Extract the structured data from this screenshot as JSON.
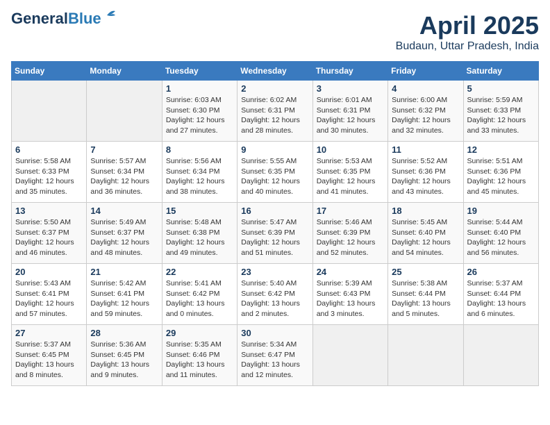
{
  "header": {
    "logo_line1": "General",
    "logo_line2": "Blue",
    "month_year": "April 2025",
    "location": "Budaun, Uttar Pradesh, India"
  },
  "days_of_week": [
    "Sunday",
    "Monday",
    "Tuesday",
    "Wednesday",
    "Thursday",
    "Friday",
    "Saturday"
  ],
  "weeks": [
    [
      {
        "day": "",
        "info": ""
      },
      {
        "day": "",
        "info": ""
      },
      {
        "day": "1",
        "info": "Sunrise: 6:03 AM\nSunset: 6:30 PM\nDaylight: 12 hours and 27 minutes."
      },
      {
        "day": "2",
        "info": "Sunrise: 6:02 AM\nSunset: 6:31 PM\nDaylight: 12 hours and 28 minutes."
      },
      {
        "day": "3",
        "info": "Sunrise: 6:01 AM\nSunset: 6:31 PM\nDaylight: 12 hours and 30 minutes."
      },
      {
        "day": "4",
        "info": "Sunrise: 6:00 AM\nSunset: 6:32 PM\nDaylight: 12 hours and 32 minutes."
      },
      {
        "day": "5",
        "info": "Sunrise: 5:59 AM\nSunset: 6:33 PM\nDaylight: 12 hours and 33 minutes."
      }
    ],
    [
      {
        "day": "6",
        "info": "Sunrise: 5:58 AM\nSunset: 6:33 PM\nDaylight: 12 hours and 35 minutes."
      },
      {
        "day": "7",
        "info": "Sunrise: 5:57 AM\nSunset: 6:34 PM\nDaylight: 12 hours and 36 minutes."
      },
      {
        "day": "8",
        "info": "Sunrise: 5:56 AM\nSunset: 6:34 PM\nDaylight: 12 hours and 38 minutes."
      },
      {
        "day": "9",
        "info": "Sunrise: 5:55 AM\nSunset: 6:35 PM\nDaylight: 12 hours and 40 minutes."
      },
      {
        "day": "10",
        "info": "Sunrise: 5:53 AM\nSunset: 6:35 PM\nDaylight: 12 hours and 41 minutes."
      },
      {
        "day": "11",
        "info": "Sunrise: 5:52 AM\nSunset: 6:36 PM\nDaylight: 12 hours and 43 minutes."
      },
      {
        "day": "12",
        "info": "Sunrise: 5:51 AM\nSunset: 6:36 PM\nDaylight: 12 hours and 45 minutes."
      }
    ],
    [
      {
        "day": "13",
        "info": "Sunrise: 5:50 AM\nSunset: 6:37 PM\nDaylight: 12 hours and 46 minutes."
      },
      {
        "day": "14",
        "info": "Sunrise: 5:49 AM\nSunset: 6:37 PM\nDaylight: 12 hours and 48 minutes."
      },
      {
        "day": "15",
        "info": "Sunrise: 5:48 AM\nSunset: 6:38 PM\nDaylight: 12 hours and 49 minutes."
      },
      {
        "day": "16",
        "info": "Sunrise: 5:47 AM\nSunset: 6:39 PM\nDaylight: 12 hours and 51 minutes."
      },
      {
        "day": "17",
        "info": "Sunrise: 5:46 AM\nSunset: 6:39 PM\nDaylight: 12 hours and 52 minutes."
      },
      {
        "day": "18",
        "info": "Sunrise: 5:45 AM\nSunset: 6:40 PM\nDaylight: 12 hours and 54 minutes."
      },
      {
        "day": "19",
        "info": "Sunrise: 5:44 AM\nSunset: 6:40 PM\nDaylight: 12 hours and 56 minutes."
      }
    ],
    [
      {
        "day": "20",
        "info": "Sunrise: 5:43 AM\nSunset: 6:41 PM\nDaylight: 12 hours and 57 minutes."
      },
      {
        "day": "21",
        "info": "Sunrise: 5:42 AM\nSunset: 6:41 PM\nDaylight: 12 hours and 59 minutes."
      },
      {
        "day": "22",
        "info": "Sunrise: 5:41 AM\nSunset: 6:42 PM\nDaylight: 13 hours and 0 minutes."
      },
      {
        "day": "23",
        "info": "Sunrise: 5:40 AM\nSunset: 6:42 PM\nDaylight: 13 hours and 2 minutes."
      },
      {
        "day": "24",
        "info": "Sunrise: 5:39 AM\nSunset: 6:43 PM\nDaylight: 13 hours and 3 minutes."
      },
      {
        "day": "25",
        "info": "Sunrise: 5:38 AM\nSunset: 6:44 PM\nDaylight: 13 hours and 5 minutes."
      },
      {
        "day": "26",
        "info": "Sunrise: 5:37 AM\nSunset: 6:44 PM\nDaylight: 13 hours and 6 minutes."
      }
    ],
    [
      {
        "day": "27",
        "info": "Sunrise: 5:37 AM\nSunset: 6:45 PM\nDaylight: 13 hours and 8 minutes."
      },
      {
        "day": "28",
        "info": "Sunrise: 5:36 AM\nSunset: 6:45 PM\nDaylight: 13 hours and 9 minutes."
      },
      {
        "day": "29",
        "info": "Sunrise: 5:35 AM\nSunset: 6:46 PM\nDaylight: 13 hours and 11 minutes."
      },
      {
        "day": "30",
        "info": "Sunrise: 5:34 AM\nSunset: 6:47 PM\nDaylight: 13 hours and 12 minutes."
      },
      {
        "day": "",
        "info": ""
      },
      {
        "day": "",
        "info": ""
      },
      {
        "day": "",
        "info": ""
      }
    ]
  ]
}
